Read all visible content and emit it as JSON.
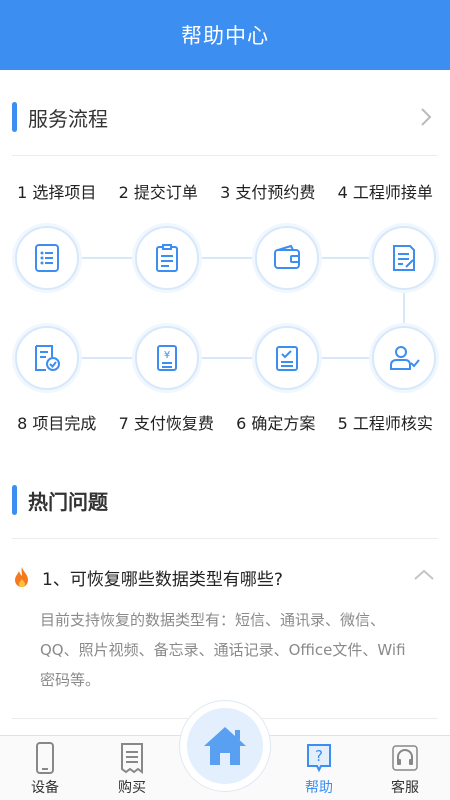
{
  "header": {
    "title": "帮助中心"
  },
  "process": {
    "title": "服务流程",
    "row1": [
      "1 选择项目",
      "2 提交订单",
      "3 支付预约费",
      "4 工程师接单"
    ],
    "row2": [
      "8 项目完成",
      "7 支付恢复费",
      "6 确定方案",
      "5 工程师核实"
    ]
  },
  "faq": {
    "title": "热门问题",
    "question": "1、可恢复哪些数据类型有哪些?",
    "answer": "目前支持恢复的数据类型有：短信、通讯录、微信、QQ、照片视频、备忘录、通话记录、Office文件、Wifi密码等。"
  },
  "tabbar": {
    "items": [
      {
        "label": "设备",
        "icon": "phone-icon"
      },
      {
        "label": "购买",
        "icon": "receipt-icon"
      },
      {
        "label": "",
        "icon": "home-icon"
      },
      {
        "label": "帮助",
        "icon": "help-icon",
        "active": true
      },
      {
        "label": "客服",
        "icon": "headset-icon"
      }
    ]
  },
  "colors": {
    "accent": "#3c8ef0",
    "node_border": "#d7e8fb",
    "answer_text": "#8a8a8a"
  }
}
